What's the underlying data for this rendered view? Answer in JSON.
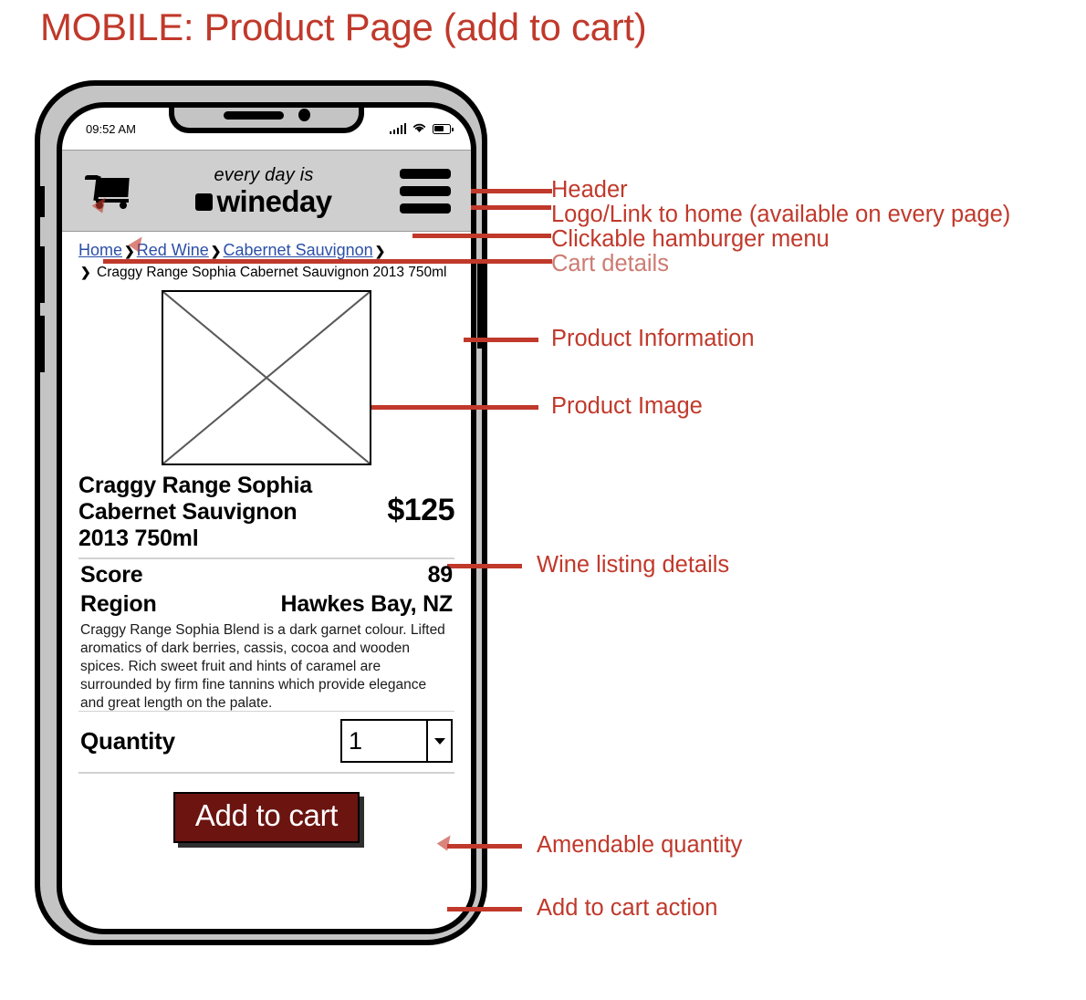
{
  "page": {
    "title": "MOBILE: Product Page (add to cart)",
    "accent_color": "#C0392B",
    "header_bg": "#cfcfcf",
    "button_color": "#6b1410",
    "link_color": "#2b4fa8"
  },
  "phone": {
    "status_bar": {
      "time": "09:52 AM",
      "signal_icon": "cellular-signal-icon",
      "wifi_icon": "wifi-icon",
      "battery_icon": "battery-icon"
    },
    "header": {
      "cart_icon": "shopping-cart-icon",
      "logo_tagline": "every day is",
      "logo_name": "wineday",
      "logo_mark": "square-icon",
      "menu_icon": "hamburger-menu-icon"
    },
    "breadcrumb": {
      "items": [
        "Home",
        "Red Wine",
        "Cabernet Sauvignon"
      ],
      "separator": "❯",
      "current": "Craggy Range Sophia Cabernet Sauvignon 2013 750ml"
    },
    "product": {
      "image_placeholder": "image-placeholder-icon",
      "name": "Craggy Range Sophia Cabernet Sauvignon 2013 750ml",
      "price": "$125",
      "specs": [
        {
          "label": "Score",
          "value": "89"
        },
        {
          "label": "Region",
          "value": "Hawkes Bay, NZ"
        }
      ],
      "description": "Craggy Range Sophia Blend is a dark garnet colour. Lifted aromatics of dark berries, cassis, cocoa and wooden spices. Rich sweet fruit and hints of caramel are surrounded by firm fine tannins which provide elegance and great length on the palate."
    },
    "quantity": {
      "label": "Quantity",
      "value": "1",
      "dropdown_icon": "chevron-down-icon"
    },
    "cta": {
      "label": "Add to cart",
      "cursor_icon": "cursor-arrow-icon"
    }
  },
  "annotations": [
    {
      "text": "Header",
      "faded": false
    },
    {
      "text": "Logo/Link to home (available on every page)",
      "faded": false
    },
    {
      "text": "Clickable hamburger menu",
      "faded": false
    },
    {
      "text": "Cart details",
      "faded": true
    },
    {
      "text": "Product Information",
      "faded": false
    },
    {
      "text": "Product Image",
      "faded": false
    },
    {
      "text": "Wine listing details",
      "faded": false
    },
    {
      "text": "Amendable quantity",
      "faded": false
    },
    {
      "text": "Add to cart action",
      "faded": false
    }
  ]
}
